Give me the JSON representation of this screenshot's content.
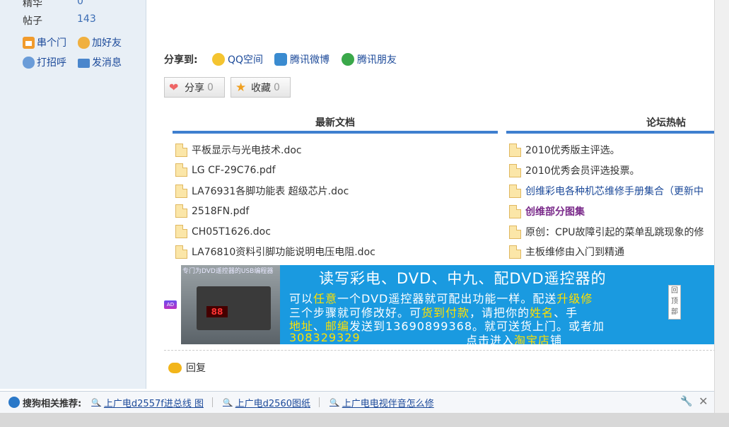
{
  "profile": {
    "stats": [
      {
        "label": "精华",
        "value": "0"
      },
      {
        "label": "帖子",
        "value": "143"
      }
    ],
    "actions": [
      {
        "label": "串个门",
        "icon": "home-icon"
      },
      {
        "label": "加好友",
        "icon": "add-friend-icon"
      },
      {
        "label": "打招呼",
        "icon": "greet-icon"
      },
      {
        "label": "发消息",
        "icon": "message-icon"
      }
    ]
  },
  "share": {
    "label": "分享到:",
    "links": [
      {
        "label": "QQ空间",
        "icon": "qzone-icon"
      },
      {
        "label": "腾讯微博",
        "icon": "tencent-weibo-icon"
      },
      {
        "label": "腾讯朋友",
        "icon": "tencent-friends-icon"
      }
    ],
    "buttons": [
      {
        "label": "分享",
        "count": "0"
      },
      {
        "label": "收藏",
        "count": "0"
      }
    ]
  },
  "columns": {
    "latest_docs": {
      "title": "最新文档",
      "items": [
        "平板显示与光电技术.doc",
        "LG CF-29C76.pdf",
        "LA76931各脚功能表 超级芯片.doc",
        "2518FN.pdf",
        "CH05T1626.doc",
        "LA76810资料引脚功能说明电压电阻.doc"
      ]
    },
    "hot_posts": {
      "title": "论坛热帖",
      "items": [
        {
          "text": "2010优秀版主评选。",
          "style": "normal"
        },
        {
          "text": "2010优秀会员评选投票。",
          "style": "normal"
        },
        {
          "text": "创维彩电各种机芯维修手册集合（更新中",
          "style": "link"
        },
        {
          "text": "创维部分图集",
          "style": "bold"
        },
        {
          "text": "原创：CPU故障引起的菜单乱跳现象的修",
          "style": "normal"
        },
        {
          "text": "主板维修由入门到精通",
          "style": "normal"
        }
      ]
    }
  },
  "banner": {
    "ad_badge": "AD",
    "photo_caption": "专门为DVD遥控器的USB编程器",
    "screen_digits": "88",
    "title": "读写彩电、DVD、中九、配DVD遥控器的",
    "line1_a": "可以",
    "line1_hl": "任意",
    "line1_b": "一个DVD遥控器就可配出功能一样。配送",
    "line1_hl2": "升级修",
    "line2_a": "三个步骤就可修改好。可",
    "line2_hl": "货到付款",
    "line2_b": "，请把你的",
    "line2_hl2": "姓名",
    "line2_c": "、手",
    "line3_hl": "地址",
    "line3_a": "、",
    "line3_hl2": "邮编",
    "line3_b": "发送到13690899368。就可送货上门。或者加",
    "line4_a": "308329329",
    "tail_a": "点击进入",
    "tail_hl": "淘宝店",
    "tail_b": "铺"
  },
  "back_to_top": "回顶部",
  "reply": {
    "label": "回复"
  },
  "rec_bar": {
    "label": "搜狗相关推荐:",
    "links": [
      "上广电d2557f进总线 图",
      "上广电d2560图纸",
      "上广电电视伴音怎么修"
    ]
  }
}
